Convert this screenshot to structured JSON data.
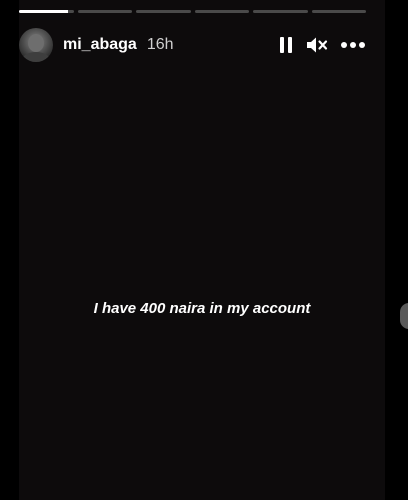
{
  "story": {
    "progress": {
      "segment_count": 6,
      "current_index": 0,
      "current_fraction": 0.9
    },
    "author": {
      "username": "mi_abaga",
      "time_ago": "16h"
    },
    "controls": {
      "pause_icon": "pause-icon",
      "mute_icon": "muted-speaker-icon",
      "more_icon": "more-horizontal-icon"
    },
    "text": "I have 400 naira in my account"
  }
}
